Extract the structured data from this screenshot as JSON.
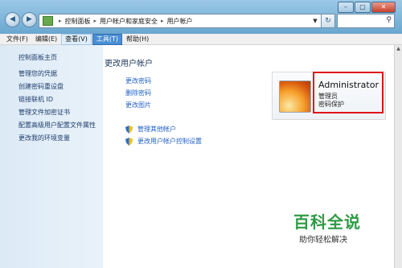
{
  "window": {
    "caption_buttons": [
      "–",
      "▢",
      "✕"
    ]
  },
  "address_bar": {
    "crumbs": [
      "控制面板",
      "用户帐户和家庭安全",
      "用户帐户"
    ],
    "separator": "▸"
  },
  "menu": {
    "items": [
      "文件(F)",
      "编辑(E)",
      "查看(V)",
      "工具(T)",
      "帮助(H)"
    ],
    "active_index": 3
  },
  "sidebar": {
    "items": [
      {
        "label": "控制面板主页"
      },
      {
        "label": "管理您的凭据"
      },
      {
        "label": "创建密码重设盘"
      },
      {
        "label": "链接联机 ID"
      },
      {
        "label": "管理文件加密证书"
      },
      {
        "label": "配置高级用户配置文件属性"
      },
      {
        "label": "更改我的环境变量"
      }
    ]
  },
  "main": {
    "heading": "更改用户帐户",
    "tasks": [
      {
        "label": "更改密码"
      },
      {
        "label": "删除密码"
      },
      {
        "label": "更改图片"
      }
    ],
    "shield_tasks": [
      {
        "label": "管理其他帐户"
      },
      {
        "label": "更改用户帐户控制设置"
      }
    ]
  },
  "user": {
    "name": "Administrator",
    "role": "管理员",
    "status": "密码保护"
  },
  "watermark": {
    "title": "百科全说",
    "subtitle": "助你轻松解决"
  },
  "colors": {
    "link": "#1f60c4",
    "heading": "#1e395b",
    "highlight": "#e0141a",
    "watermark": "#2f9a45"
  }
}
